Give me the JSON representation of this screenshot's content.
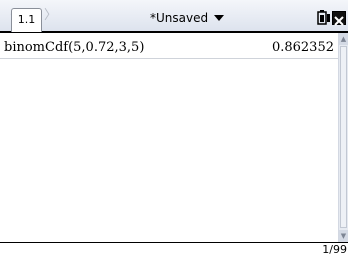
{
  "header": {
    "nav_prev": "〈",
    "nav_next": "〉",
    "tab_label": "1.1",
    "doc_title": "*Unsaved"
  },
  "icons": {
    "battery": "battery-icon",
    "close": "close-icon",
    "menu_caret": "chevron-down-icon"
  },
  "calculator": {
    "entries": [
      {
        "expression": "binomCdf(5,0.72,3,5)",
        "result": "0.862352"
      }
    ]
  },
  "status": {
    "page_counter": "1/99"
  },
  "colors": {
    "header_bg": "#dde3ee",
    "scrollbar_bg": "#e6eaf1",
    "divider": "#cfd3da"
  }
}
